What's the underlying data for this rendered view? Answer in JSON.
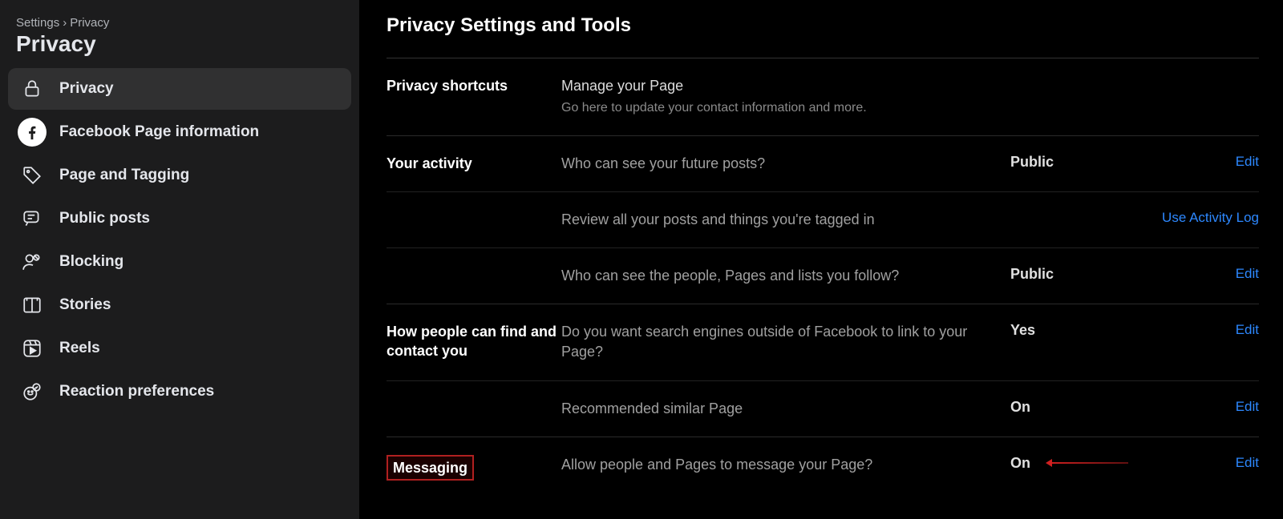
{
  "breadcrumb": {
    "root": "Settings",
    "current": "Privacy"
  },
  "pageTitle": "Privacy",
  "nav": {
    "items": [
      {
        "label": "Privacy"
      },
      {
        "label": "Facebook Page information"
      },
      {
        "label": "Page and Tagging"
      },
      {
        "label": "Public posts"
      },
      {
        "label": "Blocking"
      },
      {
        "label": "Stories"
      },
      {
        "label": "Reels"
      },
      {
        "label": "Reaction preferences"
      }
    ]
  },
  "main": {
    "title": "Privacy Settings and Tools",
    "sections": {
      "shortcuts": {
        "heading": "Privacy shortcuts",
        "primary": "Manage your Page",
        "secondary": "Go here to update your contact information and more."
      },
      "activity": {
        "heading": "Your activity",
        "rows": [
          {
            "desc": "Who can see your future posts?",
            "value": "Public",
            "action": "Edit"
          },
          {
            "desc": "Review all your posts and things you're tagged in",
            "value": "",
            "action": "Use Activity Log"
          },
          {
            "desc": "Who can see the people, Pages and lists you follow?",
            "value": "Public",
            "action": "Edit"
          }
        ]
      },
      "contact": {
        "heading": "How people can find and contact you",
        "rows": [
          {
            "desc": "Do you want search engines outside of Facebook to link to your Page?",
            "value": "Yes",
            "action": "Edit"
          },
          {
            "desc": "Recommended similar Page",
            "value": "On",
            "action": "Edit"
          }
        ]
      },
      "messaging": {
        "heading": "Messaging",
        "desc": "Allow people and Pages to message your Page?",
        "value": "On",
        "action": "Edit"
      }
    }
  }
}
